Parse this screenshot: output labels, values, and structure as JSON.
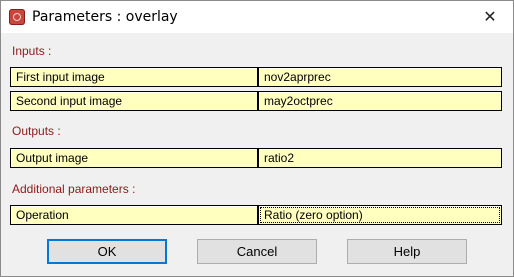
{
  "window": {
    "title": "Parameters : overlay",
    "close_glyph": "✕"
  },
  "sections": {
    "inputs_label": "Inputs :",
    "outputs_label": "Outputs :",
    "additional_label": "Additional parameters :"
  },
  "inputs": [
    {
      "label": "First input image",
      "value": "nov2aprprec"
    },
    {
      "label": "Second input image",
      "value": "may2octprec"
    }
  ],
  "outputs": [
    {
      "label": "Output image",
      "value": "ratio2"
    }
  ],
  "additional": [
    {
      "label": "Operation",
      "value": "Ratio (zero option)"
    }
  ],
  "buttons": {
    "ok": "OK",
    "cancel": "Cancel",
    "help": "Help"
  },
  "colors": {
    "field_bg": "#ffffc0",
    "section_label": "#8b1a1a"
  },
  "icons": {
    "app": "app-icon",
    "close": "close-icon"
  }
}
